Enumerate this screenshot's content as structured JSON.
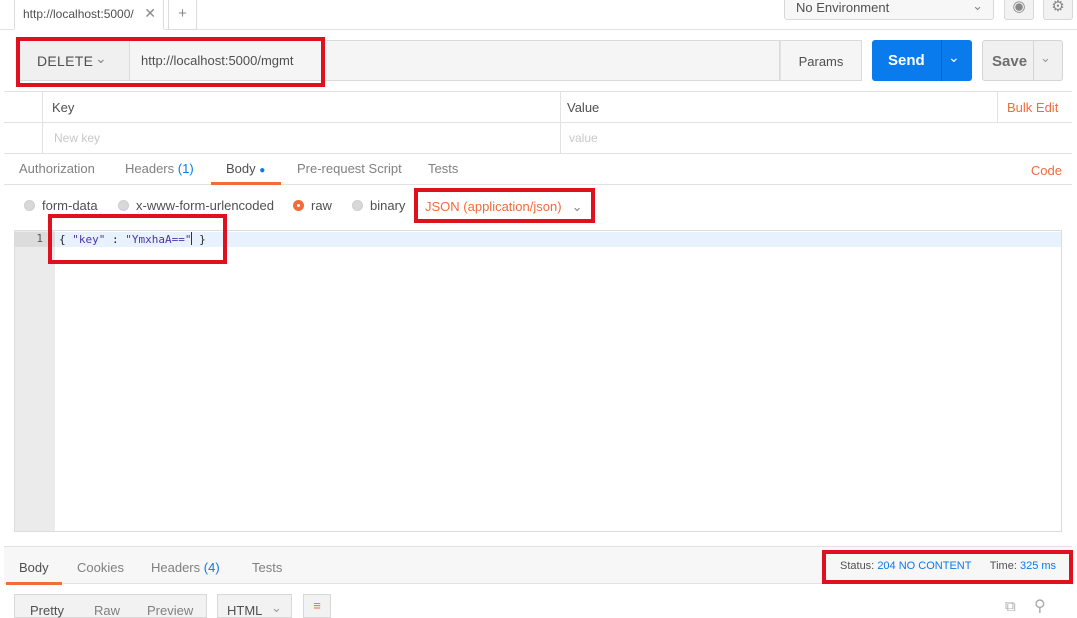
{
  "tab": {
    "title": "http://localhost:5000/",
    "close_glyph": "✕",
    "new_glyph": "+"
  },
  "environment": {
    "selected": "No Environment"
  },
  "request": {
    "method": "DELETE",
    "url": "http://localhost:5000/mgmt",
    "params_label": "Params",
    "send_label": "Send",
    "save_label": "Save"
  },
  "params_table": {
    "key_header": "Key",
    "value_header": "Value",
    "bulk_edit": "Bulk Edit",
    "key_placeholder": "New key",
    "value_placeholder": "value"
  },
  "request_tabs": {
    "authorization": "Authorization",
    "headers": "Headers",
    "headers_count": "(1)",
    "body": "Body",
    "pre_request": "Pre-request Script",
    "tests": "Tests",
    "code": "Code"
  },
  "body_types": {
    "form_data": "form-data",
    "urlencoded": "x-www-form-urlencoded",
    "raw": "raw",
    "binary": "binary",
    "content_type": "JSON (application/json)",
    "selected": "raw"
  },
  "editor": {
    "line_number": "1",
    "open": "{ ",
    "key": "\"key\"",
    "sep": " : ",
    "value": "\"YmxhaA==\"",
    "close": " }"
  },
  "response_tabs": {
    "body": "Body",
    "cookies": "Cookies",
    "headers": "Headers",
    "headers_count": "(4)",
    "tests": "Tests"
  },
  "response_status": {
    "status_label": "Status:",
    "status_value": "204 NO CONTENT",
    "time_label": "Time:",
    "time_value": "325 ms"
  },
  "response_toolbar": {
    "pretty": "Pretty",
    "raw": "Raw",
    "preview": "Preview",
    "format": "HTML"
  },
  "colors": {
    "accent_orange": "#f26b3a",
    "send_blue": "#097bed",
    "annotation_red": "#e0111e"
  }
}
